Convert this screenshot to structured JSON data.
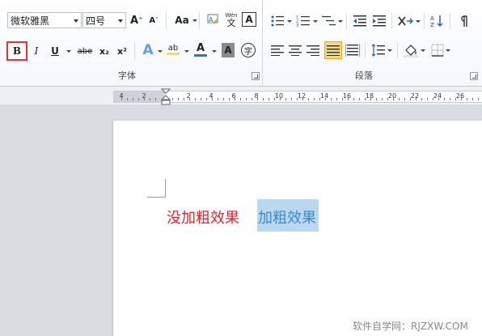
{
  "font_group": {
    "label": "字体",
    "font_name": "微软雅黑",
    "font_size": "四号",
    "grow_label": "A",
    "shrink_label": "A",
    "change_case_label": "Aa",
    "pinyin_label": "文",
    "clear_format_label": "Wén",
    "char_border_label": "A",
    "bold_label": "B",
    "italic_label": "I",
    "underline_label": "U",
    "strike_label": "abe",
    "subscript_label": "x₂",
    "superscript_label": "x²",
    "text_effect_label": "A",
    "highlight_label": "ab",
    "font_color_label": "A",
    "char_shading_label": "A",
    "enclose_label": "字"
  },
  "paragraph_group": {
    "label": "段落"
  },
  "ruler": {
    "ticks": [
      "4",
      "2",
      "2",
      "4",
      "6",
      "8",
      "10",
      "12",
      "14",
      "16",
      "18",
      "20",
      "22",
      "24",
      "26"
    ]
  },
  "document": {
    "text_normal": "没加粗效果",
    "text_selected": "加粗效果"
  },
  "watermark": "软件自学网：RJZXW.COM",
  "colors": {
    "bold_highlight": "#e8332f",
    "red_text": "#e8222a",
    "blue_text": "#3a8ad0",
    "selection": "#bcd8ee",
    "font_color_bar": "#2f6fd0",
    "highlight_bar": "#f3e23a"
  }
}
